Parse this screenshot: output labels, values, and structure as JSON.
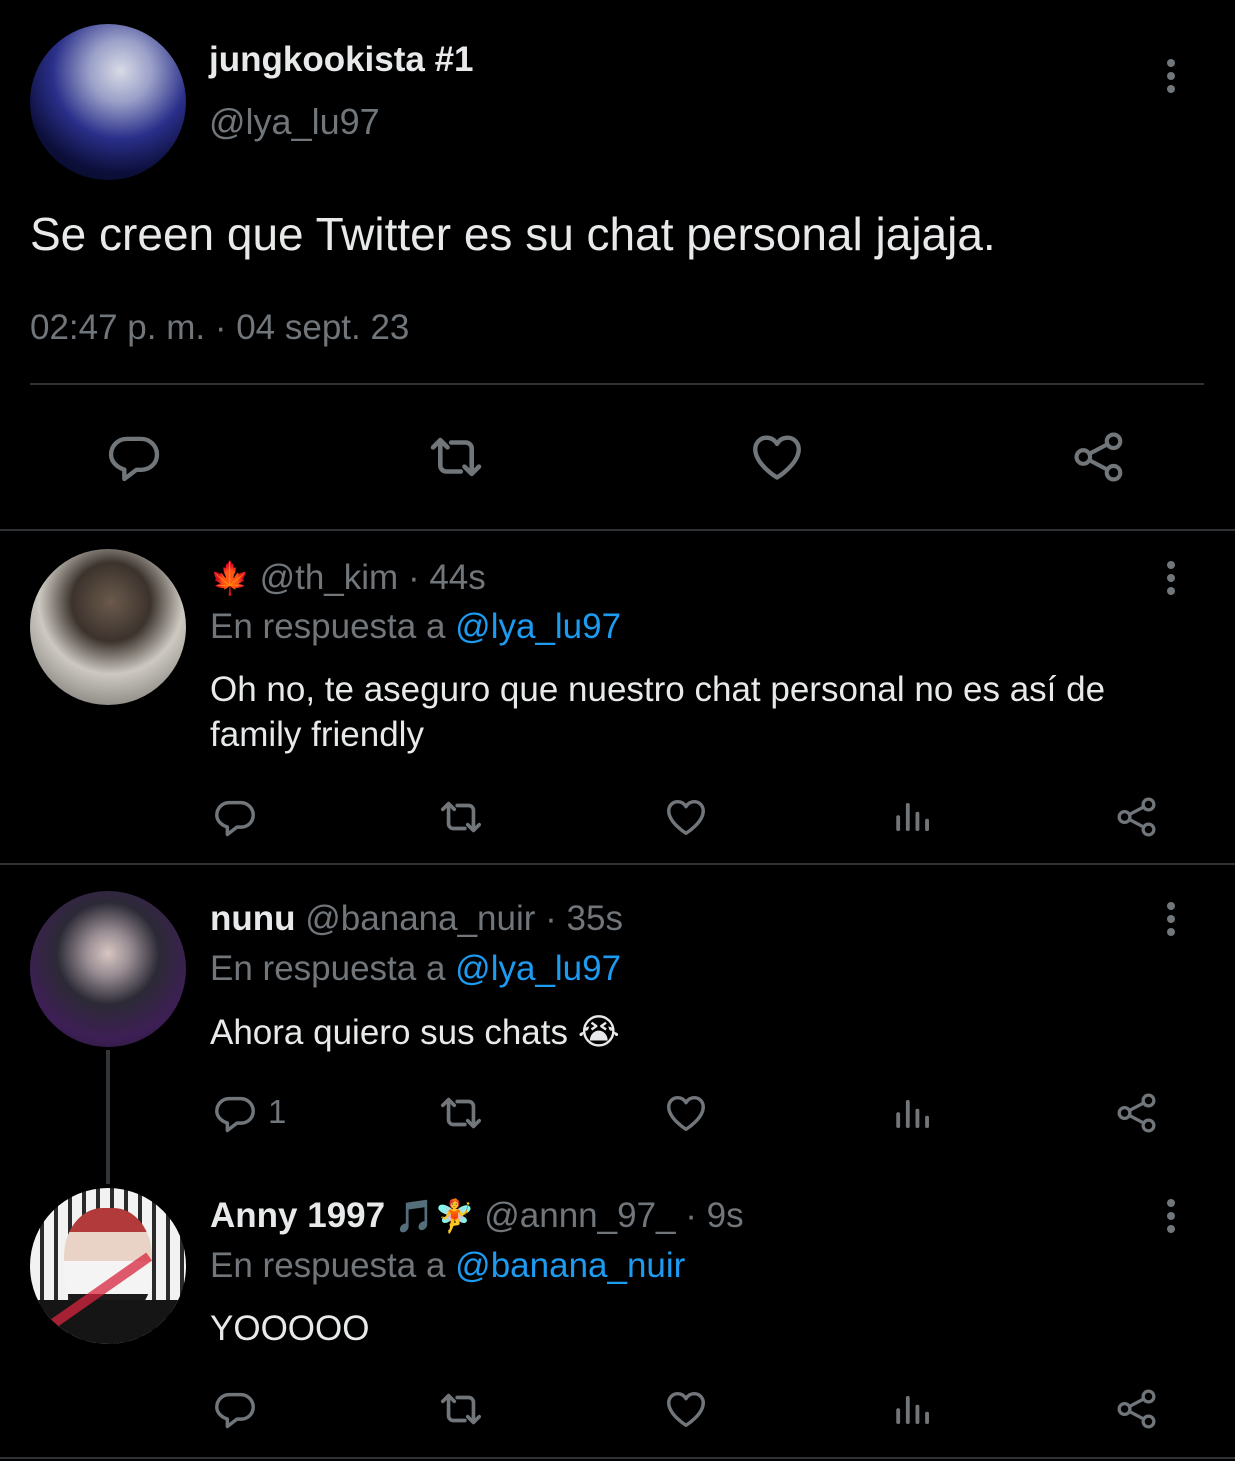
{
  "main_tweet": {
    "display_name": "jungkookista #1",
    "handle": "@lya_lu97",
    "text": "Se creen que Twitter es su chat personal jajaja.",
    "timestamp": "02:47 p. m. · 04 sept. 23"
  },
  "replies": [
    {
      "name_emoji": "🍁",
      "handle": "@th_kim",
      "age": "· 44s",
      "reply_prefix": "En respuesta a",
      "reply_to": "@lya_lu97",
      "text_line1": "Oh no, te aseguro que nuestro chat personal no es así de",
      "text_line2": "family friendly"
    },
    {
      "display_name": "nunu",
      "handle": "@banana_nuir",
      "age": "· 35s",
      "reply_prefix": "En respuesta a",
      "reply_to": "@lya_lu97",
      "text": "Ahora quiero sus chats",
      "text_emoji": "😭",
      "reply_count": "1"
    },
    {
      "display_name": "Anny 1997",
      "name_emoji": "🎵🧚",
      "handle": "@annn_97_",
      "age": "· 9s",
      "reply_prefix": "En respuesta a",
      "reply_to": "@banana_nuir",
      "text": "YOOOOO"
    }
  ],
  "icons": {
    "reply": "reply-icon",
    "retweet": "retweet-icon",
    "like": "heart-icon",
    "views": "views-icon",
    "share": "share-icon",
    "more": "more-options-icon"
  },
  "colors": {
    "background": "#000000",
    "text": "#e7e9ea",
    "muted": "#71767b",
    "link": "#1d9bf0",
    "divider": "#2f3336"
  }
}
